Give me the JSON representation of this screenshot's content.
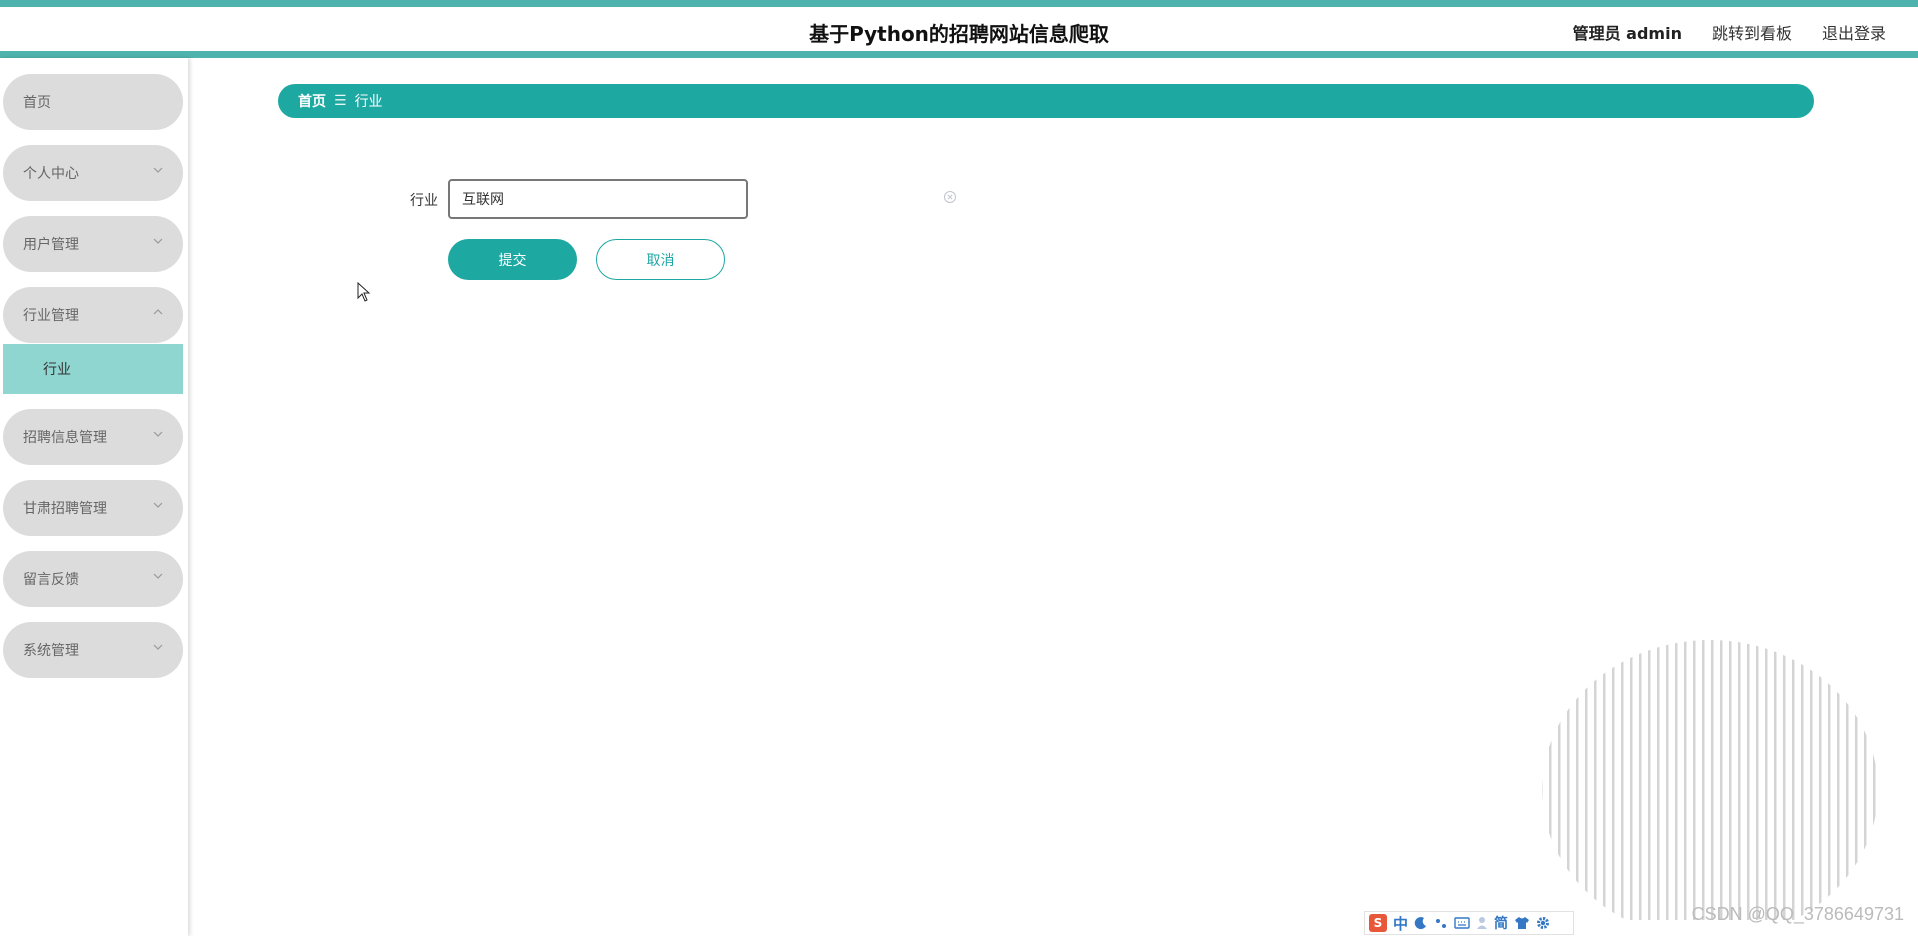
{
  "header": {
    "title": "基于Python的招聘网站信息爬取",
    "user_label": "管理员 admin",
    "board_link": "跳转到看板",
    "logout_link": "退出登录"
  },
  "sidebar": {
    "items": [
      {
        "label": "首页"
      },
      {
        "label": "个人中心"
      },
      {
        "label": "用户管理"
      },
      {
        "label": "行业管理"
      },
      {
        "label": "招聘信息管理"
      },
      {
        "label": "甘肃招聘管理"
      },
      {
        "label": "留言反馈"
      },
      {
        "label": "系统管理"
      }
    ],
    "submenu": {
      "label": "行业"
    }
  },
  "breadcrumb": {
    "home": "首页",
    "separator": "☰",
    "current": "行业"
  },
  "form": {
    "industry_label": "行业",
    "industry_value": "互联网",
    "submit_label": "提交",
    "cancel_label": "取消"
  },
  "ime": {
    "logo": "S",
    "chinese": "中",
    "simplified": "简"
  },
  "watermark": "CSDN @QQ_3786649731",
  "colors": {
    "accent": "#1ea8a2",
    "accent_light": "#8fd6d1",
    "top_border": "#4fb3ad",
    "menu_bg": "#dcdcdc"
  }
}
